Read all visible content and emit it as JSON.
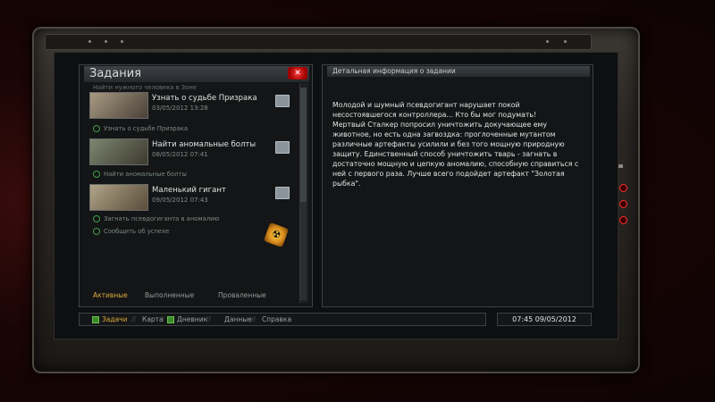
{
  "window": {
    "left_panel_title": "Задания",
    "right_panel_title": "Детальная информация о задании"
  },
  "tasks_list": {
    "cutoff_item": "Найти нужного человека в Зоне",
    "tasks": [
      {
        "name": "Узнать о судьбе Призрака",
        "date": "03/05/2012 13:28",
        "subtask": "Узнать о судьбе Призрака"
      },
      {
        "name": "Найти аномальные болты",
        "date": "08/05/2012 07:41",
        "subtask": "Найти аномальные болты"
      },
      {
        "name": "Маленький гигант",
        "date": "09/05/2012 07:43",
        "subtask": "Загнать псевдогиганта в аномалию"
      }
    ],
    "extra_subtask": "Сообщить об успехе"
  },
  "detail": {
    "text": "Молодой и шумный псевдогигант нарушает покой несостоявшегося контроллера... Кто бы мог подумать!\nМертвый Сталкер попросил уничтожить докучающее ему животное, но есть одна загвоздка: проглоченные мутантом различные артефакты усилили и без того мощную природную защиту. Единственный способ уничтожить тварь - загнать в достаточно мощную и цепкую аномалию, способную справиться с ней с первого раза. Лучше всего подойдет артефакт \"Золотая рыбка\"."
  },
  "tabs": {
    "active": "Активные",
    "completed": "Выполненные",
    "failed": "Проваленные"
  },
  "nav": {
    "tasks": "Задачи",
    "map": "Карта",
    "diary": "Дневник",
    "data": "Данные",
    "reference": "Справка"
  },
  "clock": "07:45  09/05/2012",
  "colors": {
    "accent": "#e0a83c",
    "status_green": "#41a04a",
    "alert_red": "#ff3030"
  }
}
